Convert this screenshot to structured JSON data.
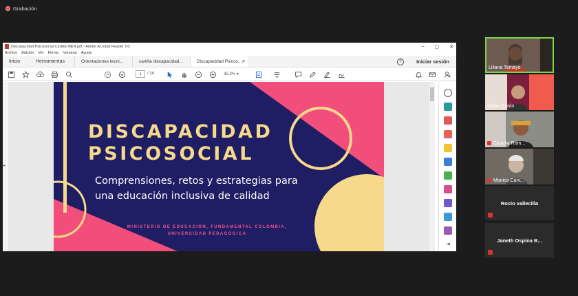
{
  "recording": {
    "label": "Grabación"
  },
  "window": {
    "title": "Discapacidad Psicosocial Cartilla MEN.pdf - Adobe Acrobat Reader DC",
    "controls": [
      "–",
      "▢",
      "✕"
    ]
  },
  "menu": [
    "Archivo",
    "Edición",
    "Ver",
    "Firmar",
    "Ventana",
    "Ayuda"
  ],
  "tabs": {
    "home": "Inicio",
    "tools": "Herramientas",
    "documents": [
      {
        "label": "Orientaciones tecni...",
        "active": false
      },
      {
        "label": "cartilla discapacidad...",
        "active": false
      },
      {
        "label": "Discapacidad Psicos...",
        "active": true
      }
    ],
    "close_glyph": "✕",
    "help_glyph": "?",
    "signin": "Iniciar sesión"
  },
  "toolbar": {
    "page_current": "1",
    "page_total": "/ 14",
    "zoom": "45,3%"
  },
  "slide": {
    "title_line1": "DISCAPACIDAD",
    "title_line2": "PSICOSOCIAL",
    "subtitle": "Comprensiones, retos y estrategias para una educación inclusiva de calidad",
    "org_line1": "MINISTERIO DE EDUCACIÓN, FUNDAMENTAL COLOMBIA,",
    "org_line2": "UNIVERSIDAD PEDAGÓGICA",
    "colors": {
      "navy": "#1f1d64",
      "pink": "#f14e7c",
      "yellow": "#f7d98b"
    }
  },
  "participants": [
    {
      "name": "Liliana Tamayo",
      "video": true,
      "muted": false,
      "active_speaker": true
    },
    {
      "name": "Julian Cerón",
      "video": true,
      "muted": false
    },
    {
      "name": "Claudia Rom...",
      "video": true,
      "muted": true
    },
    {
      "name": "Monica Carv...",
      "video": true,
      "muted": true
    },
    {
      "name": "Rocio vallecilla",
      "video": false,
      "muted": true
    },
    {
      "name": "Janeth Ospina B...",
      "video": false,
      "muted": true
    }
  ]
}
